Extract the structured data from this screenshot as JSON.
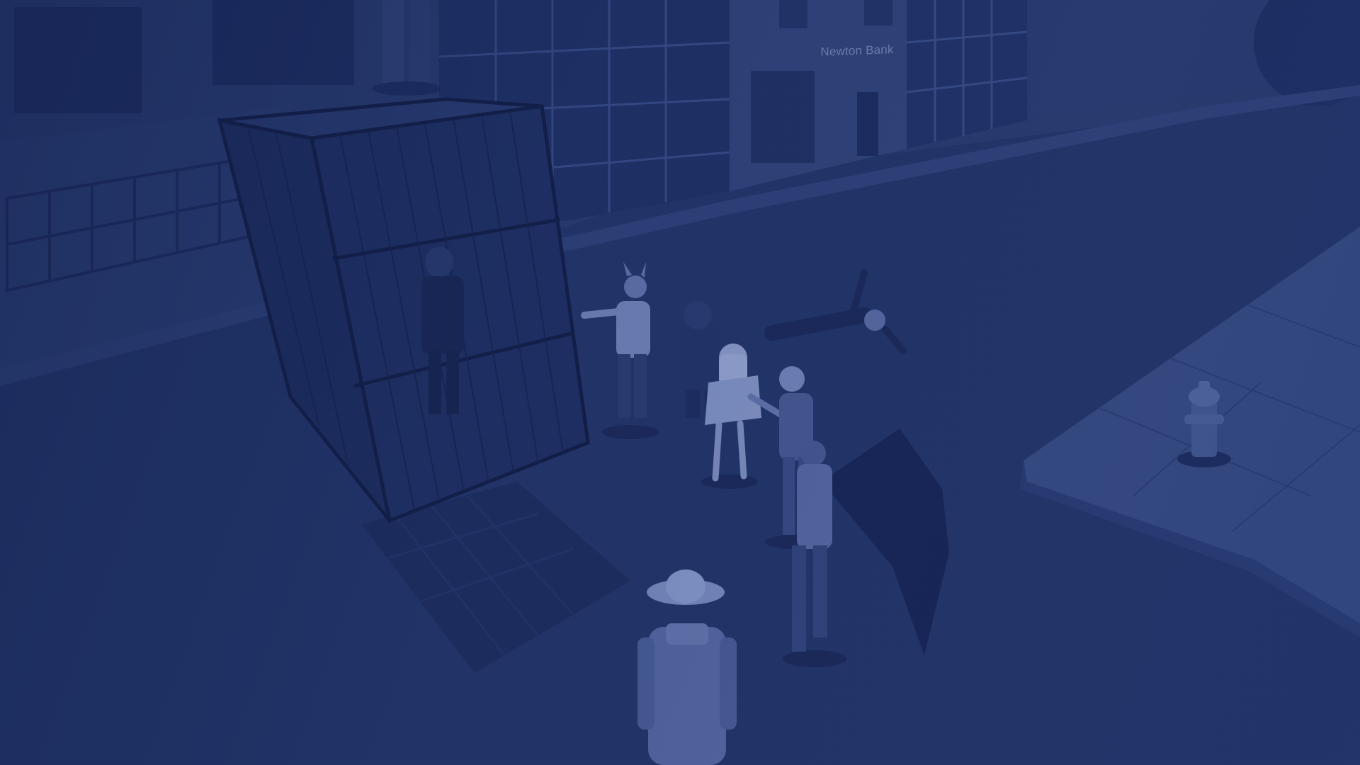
{
  "scene": {
    "storefront_sign": "Newton Bank"
  },
  "palette": {
    "overlay": "#1e3266",
    "street": "#26386c",
    "sidewalk": "#3a4e85",
    "building": "#2a3c70",
    "window": "#1a2a5a",
    "figure_light": "#8a9ac8",
    "figure_dark": "#16244e"
  }
}
